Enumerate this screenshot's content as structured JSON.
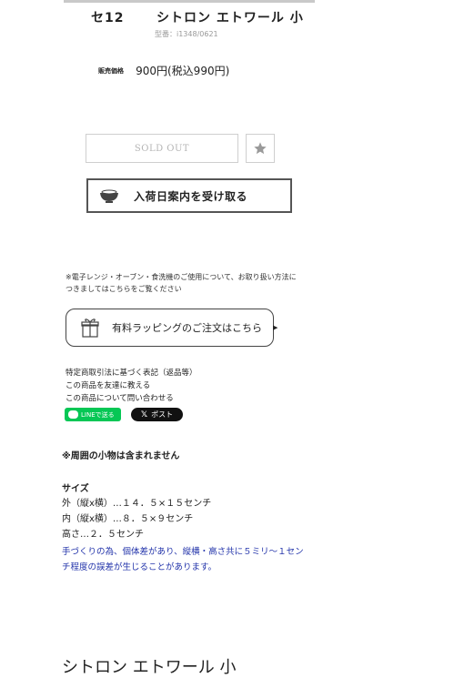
{
  "product": {
    "code": "セ12",
    "name": "シトロン エトワール 小",
    "item_number": "型番：i1348/0621",
    "price_label": "販売価格",
    "price": "900円(税込990円)"
  },
  "actions": {
    "sold_out": "SOLD OUT",
    "restock": "入荷日案内を受け取る"
  },
  "care_note": [
    "※電子レンジ・オーブン・食洗機のご使用について、お取り扱い方法に",
    "つきましてはこちらをご覧ください"
  ],
  "wrapping": {
    "label": "有料ラッピングのご注文はこちら",
    "arrow": "▶"
  },
  "links": [
    "特定商取引法に基づく表記（返品等）",
    "この商品を友達に教える",
    "この商品について問い合わせる"
  ],
  "share": {
    "line": "LINEで送る",
    "x_glyph": "𝕏",
    "x": "ポスト"
  },
  "description": {
    "notice": "※周囲の小物は含まれません",
    "size_heading": "サイズ",
    "sizes": [
      "外（縦x横）…１４．５×１５センチ",
      "内（縦x横）…８．５×９センチ",
      "高さ…２．５センチ"
    ],
    "note": [
      "手づくりの為、個体差があり、縦横・高さ共に５ミリ～１セン",
      "チ程度の誤差が生じることがあります。"
    ]
  },
  "bottom_title": "シトロン エトワール 小",
  "colors": {
    "line_green": "#06c755",
    "x_black": "#111111",
    "note_blue": "#2233aa"
  },
  "icons": [
    "star-icon",
    "bowl-icon",
    "gift-icon",
    "line-icon"
  ]
}
